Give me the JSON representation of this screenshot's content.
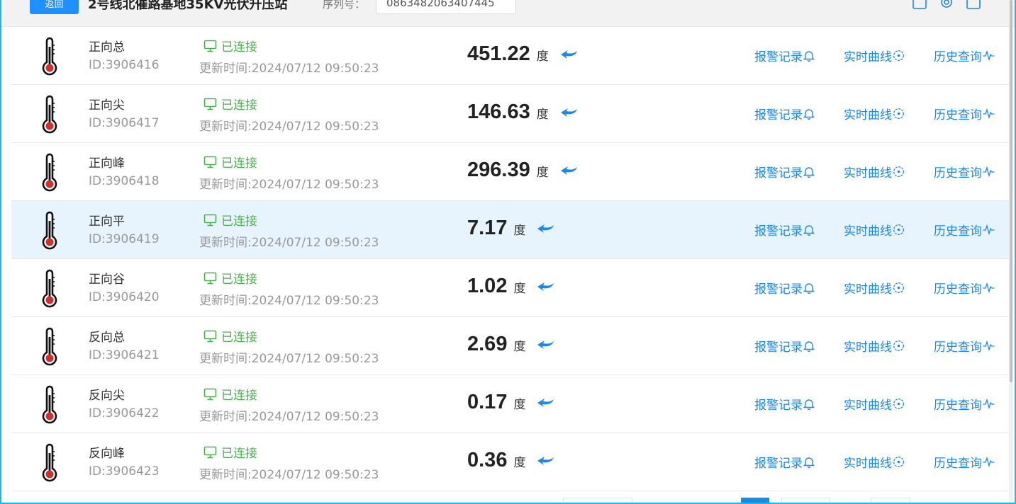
{
  "header": {
    "back_label": "返回",
    "title": "2号线北催路基地35KV光伏升压站",
    "serial_label": "序列号：",
    "serial_value": "0863482063407445"
  },
  "colors": {
    "accent": "#1e88e5",
    "connected": "#4caf50",
    "highlight_row": "#e8f4fd",
    "frame_border": "#1fb6ee"
  },
  "actions": {
    "alarm": "报警记录",
    "curve": "实时曲线",
    "history": "历史查询"
  },
  "rows": [
    {
      "name": "正向总",
      "id": "ID:3906416",
      "status": "已连接",
      "update": "更新时间:2024/07/12 09:50:23",
      "value": "451.22",
      "unit": "度"
    },
    {
      "name": "正向尖",
      "id": "ID:3906417",
      "status": "已连接",
      "update": "更新时间:2024/07/12 09:50:23",
      "value": "146.63",
      "unit": "度"
    },
    {
      "name": "正向峰",
      "id": "ID:3906418",
      "status": "已连接",
      "update": "更新时间:2024/07/12 09:50:23",
      "value": "296.39",
      "unit": "度"
    },
    {
      "name": "正向平",
      "id": "ID:3906419",
      "status": "已连接",
      "update": "更新时间:2024/07/12 09:50:23",
      "value": "7.17",
      "unit": "度"
    },
    {
      "name": "正向谷",
      "id": "ID:3906420",
      "status": "已连接",
      "update": "更新时间:2024/07/12 09:50:23",
      "value": "1.02",
      "unit": "度"
    },
    {
      "name": "反向总",
      "id": "ID:3906421",
      "status": "已连接",
      "update": "更新时间:2024/07/12 09:50:23",
      "value": "2.69",
      "unit": "度"
    },
    {
      "name": "反向尖",
      "id": "ID:3906422",
      "status": "已连接",
      "update": "更新时间:2024/07/12 09:50:23",
      "value": "0.17",
      "unit": "度"
    },
    {
      "name": "反向峰",
      "id": "ID:3906423",
      "status": "已连接",
      "update": "更新时间:2024/07/12 09:50:23",
      "value": "0.36",
      "unit": "度"
    }
  ],
  "icons": {
    "row_icon": "thermometer-icon",
    "status_icon": "monitor-icon",
    "value_icon": "reply-arrow-icon",
    "alarm_icon": "bell-icon",
    "curve_icon": "target-icon",
    "history_icon": "pulse-icon"
  }
}
